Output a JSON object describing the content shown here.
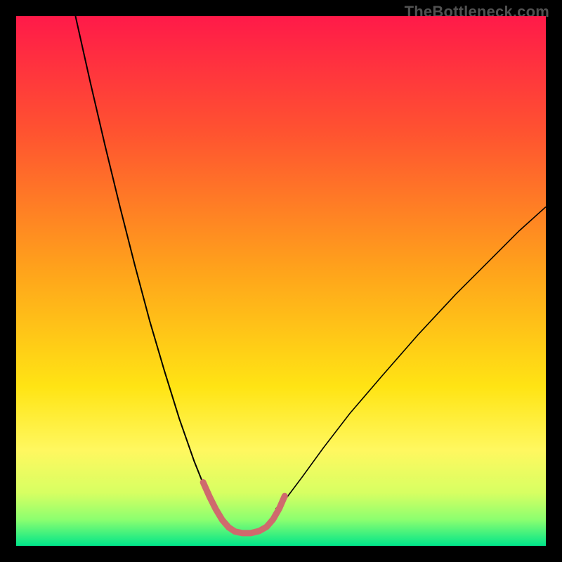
{
  "watermark": "TheBottleneck.com",
  "chart_data": {
    "type": "line",
    "title": "",
    "xlabel": "",
    "ylabel": "",
    "xlim": [
      0,
      100
    ],
    "ylim": [
      0,
      100
    ],
    "grid": false,
    "legend": false,
    "background_gradient_stops": [
      {
        "offset": 0.0,
        "color": "#ff1a49"
      },
      {
        "offset": 0.22,
        "color": "#ff5330"
      },
      {
        "offset": 0.48,
        "color": "#ffa31b"
      },
      {
        "offset": 0.7,
        "color": "#ffe414"
      },
      {
        "offset": 0.82,
        "color": "#fff860"
      },
      {
        "offset": 0.9,
        "color": "#d7ff62"
      },
      {
        "offset": 0.95,
        "color": "#8dff6f"
      },
      {
        "offset": 1.0,
        "color": "#00e58a"
      }
    ],
    "series": [
      {
        "name": "left-curve",
        "stroke": "#000000",
        "stroke_width": 2.0,
        "x": [
          11.2,
          14.0,
          16.8,
          19.6,
          22.4,
          25.2,
          28.0,
          30.8,
          33.6,
          35.0,
          36.4,
          37.8
        ],
        "y": [
          100.0,
          87.5,
          75.5,
          64.0,
          53.0,
          42.5,
          33.0,
          24.0,
          16.0,
          12.5,
          9.5,
          7.0
        ]
      },
      {
        "name": "right-curve",
        "stroke": "#000000",
        "stroke_width": 1.6,
        "x": [
          49.0,
          51.0,
          54.0,
          58.0,
          63.0,
          69.0,
          76.0,
          83.0,
          90.0,
          95.0,
          100.0
        ],
        "y": [
          7.0,
          9.0,
          13.0,
          18.5,
          25.0,
          32.0,
          40.0,
          47.5,
          54.5,
          59.5,
          64.0
        ]
      },
      {
        "name": "highlight-segment",
        "stroke": "#cf6a6d",
        "stroke_width": 9,
        "linecap": "round",
        "x": [
          35.3,
          36.5,
          37.7,
          38.9,
          40.1,
          41.3,
          42.7,
          44.3,
          45.9,
          47.3,
          48.5,
          49.7,
          50.7
        ],
        "y": [
          12.0,
          9.3,
          6.9,
          4.9,
          3.5,
          2.7,
          2.4,
          2.4,
          2.8,
          3.6,
          5.0,
          7.1,
          9.4
        ]
      }
    ],
    "annotations": []
  }
}
